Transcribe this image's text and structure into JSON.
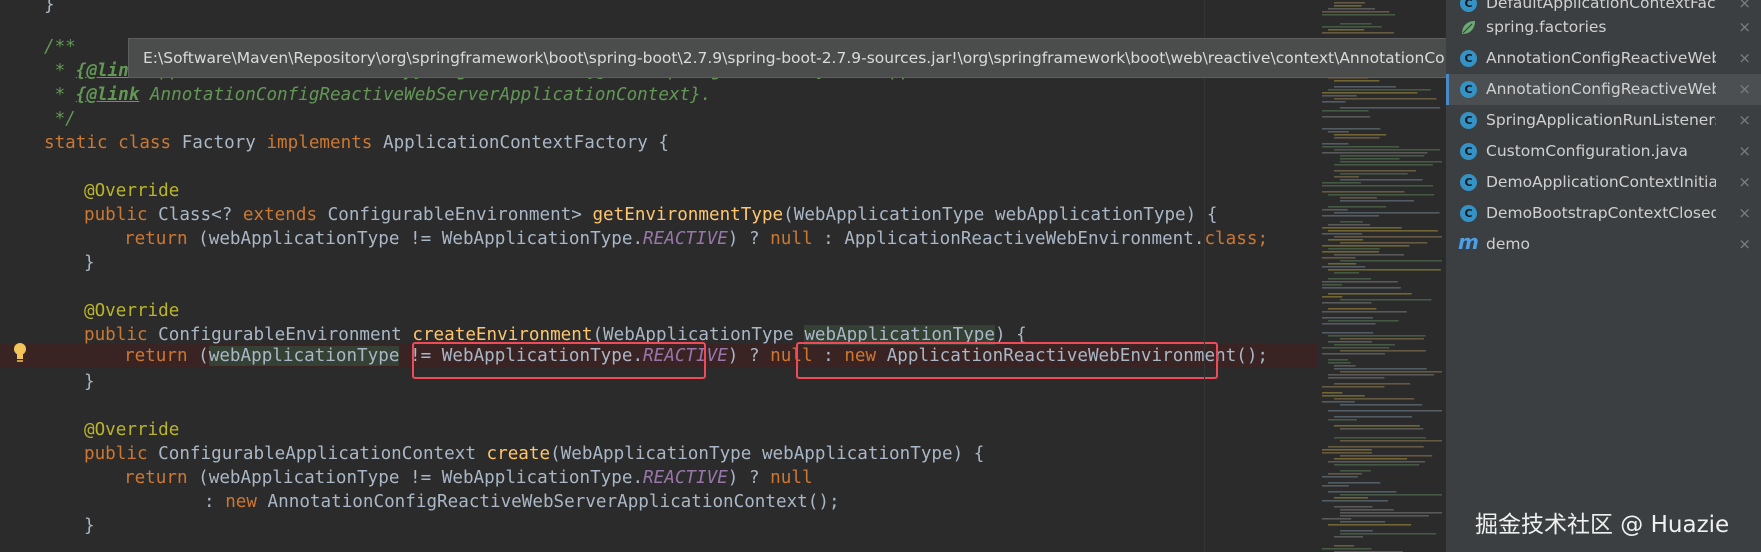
{
  "tooltip": {
    "path": "E:\\Software\\Maven\\Repository\\org\\springframework\\boot\\spring-boot\\2.7.9\\spring-boot-2.7.9-sources.jar!\\org\\springframework\\boot\\web\\reactive\\context\\AnnotationConfigReactiveWebServerApplicationContext.java"
  },
  "code": {
    "l1": {
      "t": "}"
    },
    "l2": {
      "t": "/**"
    },
    "l3": {
      "a": " * ",
      "b": "{@link",
      "c": " ApplicationContextFactory} registered in {@link SpringFactories} to support"
    },
    "l4": {
      "a": " * ",
      "b": "{@link",
      "c": " AnnotationConfigReactiveWebServerApplicationContext}."
    },
    "l5": {
      "t": " */"
    },
    "l6": {
      "kw1": "static class",
      "s1": " Factory ",
      "kw2": "implements",
      "s2": " ApplicationContextFactory {"
    },
    "l8": {
      "ann": "@Override"
    },
    "l9": {
      "kw1": "public",
      "s1": " Class<? ",
      "kw2": "extends",
      "s2": " ConfigurableEnvironment> ",
      "fn": "getEnvironmentType",
      "s3": "(WebApplicationType webApplicationType) {"
    },
    "l10": {
      "kw1": "return",
      "s1": " (webApplicationType != WebApplicationType.",
      "st": "REACTIVE",
      "s2": ") ? ",
      "kw2": "null",
      "s3": " : ApplicationReactiveWebEnvironment.",
      "kw3": "class",
      "s4": ";"
    },
    "l11": {
      "t": "}"
    },
    "l13": {
      "ann": "@Override"
    },
    "l14": {
      "kw1": "public",
      "s1": " ConfigurableEnvironment ",
      "fn": "createEnvironment",
      "s2": "(WebApplicationType ",
      "par": "webApplicationType",
      "s3": ") {"
    },
    "l15": {
      "kw1": "return",
      "s1": " (",
      "par": "webApplicationType",
      "s2": " != WebApplicationType.",
      "st": "REACTIVE",
      "s3": ") ? ",
      "kw2": "null",
      "s4": " : ",
      "kw3": "new",
      "s5": " ApplicationReactiveWebEnvironment();"
    },
    "l16": {
      "t": "}"
    },
    "l18": {
      "ann": "@Override"
    },
    "l19": {
      "kw1": "public",
      "s1": " ConfigurableApplicationContext ",
      "fn": "create",
      "s2": "(WebApplicationType webApplicationType) {"
    },
    "l20": {
      "kw1": "return",
      "s1": " (webApplicationType != WebApplicationType.",
      "st": "REACTIVE",
      "s2": ") ? ",
      "kw2": "null"
    },
    "l21": {
      "s1": ": ",
      "kw1": "new",
      "s2": " AnnotationConfigReactiveWebServerApplicationContext();"
    },
    "l22": {
      "t": "}"
    }
  },
  "switcher": {
    "items": [
      {
        "label": "DefaultApplicationContextFactory",
        "icon": "class-icon"
      },
      {
        "label": "spring.factories",
        "icon": "spring-leaf-icon"
      },
      {
        "label": "AnnotationConfigReactiveWebServerApplicationContext.java",
        "icon": "class-icon"
      },
      {
        "label": "AnnotationConfigReactiveWebSer",
        "icon": "class-icon"
      },
      {
        "label": "SpringApplicationRunListeners.java",
        "icon": "class-icon"
      },
      {
        "label": "CustomConfiguration.java",
        "icon": "class-icon"
      },
      {
        "label": "DemoApplicationContextInitializer",
        "icon": "class-icon"
      },
      {
        "label": "DemoBootstrapContextClosedListener",
        "icon": "class-icon"
      },
      {
        "label": "demo",
        "icon": "maven-icon"
      }
    ],
    "close_glyph": "×",
    "class_glyph": "C",
    "maven_glyph": "m"
  },
  "watermark": "掘金技术社区 @ Huazie",
  "colors": {
    "background": "#2b2b2b",
    "keyword": "#cc7832",
    "annotation": "#bbb529",
    "method": "#ffc66d",
    "comment": "#629755",
    "static_field": "#9876aa",
    "highlight_box": "#f04a58",
    "switcher_bg": "#3c3f41"
  }
}
